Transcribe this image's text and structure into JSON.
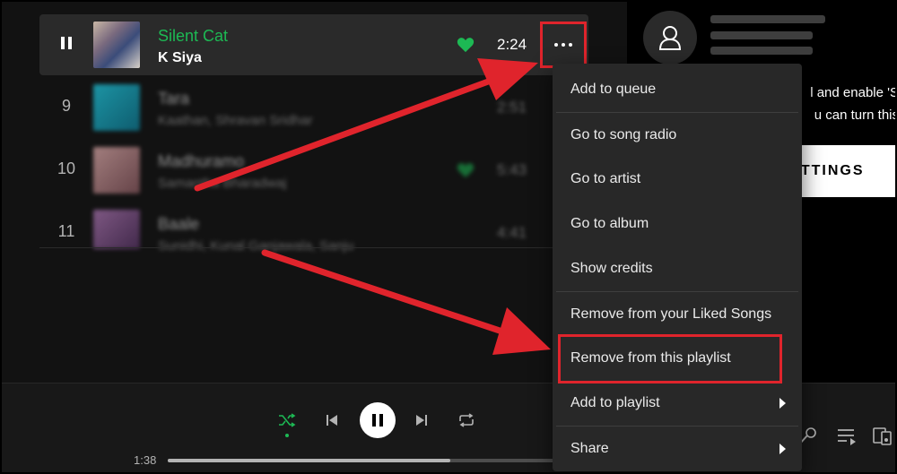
{
  "tracks": [
    {
      "num": "",
      "title": "Silent Cat",
      "artist": "K Siya",
      "duration": "2:24",
      "liked": true,
      "playing": true
    },
    {
      "num": "9",
      "title": "Tara",
      "artist": "Kaathan, Shravan Sridhar",
      "duration": "2:51",
      "liked": false
    },
    {
      "num": "10",
      "title": "Madhuramo",
      "artist": "Samantha Bharadwaj",
      "duration": "5:43",
      "liked": true
    },
    {
      "num": "11",
      "title": "Baale",
      "artist": "Sunidhi, Kunal Ganjawala, Sanju",
      "duration": "4:41",
      "liked": false
    }
  ],
  "context_menu": {
    "items": [
      {
        "label": "Add to queue",
        "submenu": false
      },
      {
        "label": "Go to song radio",
        "submenu": false
      },
      {
        "label": "Go to artist",
        "submenu": false
      },
      {
        "label": "Go to album",
        "submenu": false
      },
      {
        "label": "Show credits",
        "submenu": false
      },
      {
        "label": "Remove from your Liked Songs",
        "submenu": false
      },
      {
        "label": "Remove from this playlist",
        "submenu": false
      },
      {
        "label": "Add to playlist",
        "submenu": true
      },
      {
        "label": "Share",
        "submenu": true
      }
    ]
  },
  "right_panel": {
    "line1": "l and enable 'S",
    "line2": "u can turn this",
    "settings_button": "SETTINGS"
  },
  "player": {
    "elapsed": "1:38",
    "progress_fraction": 0.7
  },
  "colors": {
    "accent_green": "#1db954",
    "annotation_red": "#e0242c",
    "background": "#121212",
    "menu_bg": "#282828"
  },
  "icons": [
    "pause-icon",
    "heart-icon",
    "more-options-icon",
    "user-icon",
    "shuffle-icon",
    "previous-icon",
    "play-pause-icon",
    "next-icon",
    "repeat-icon",
    "lyrics-icon",
    "queue-icon",
    "devices-icon",
    "chevron-right-icon"
  ]
}
